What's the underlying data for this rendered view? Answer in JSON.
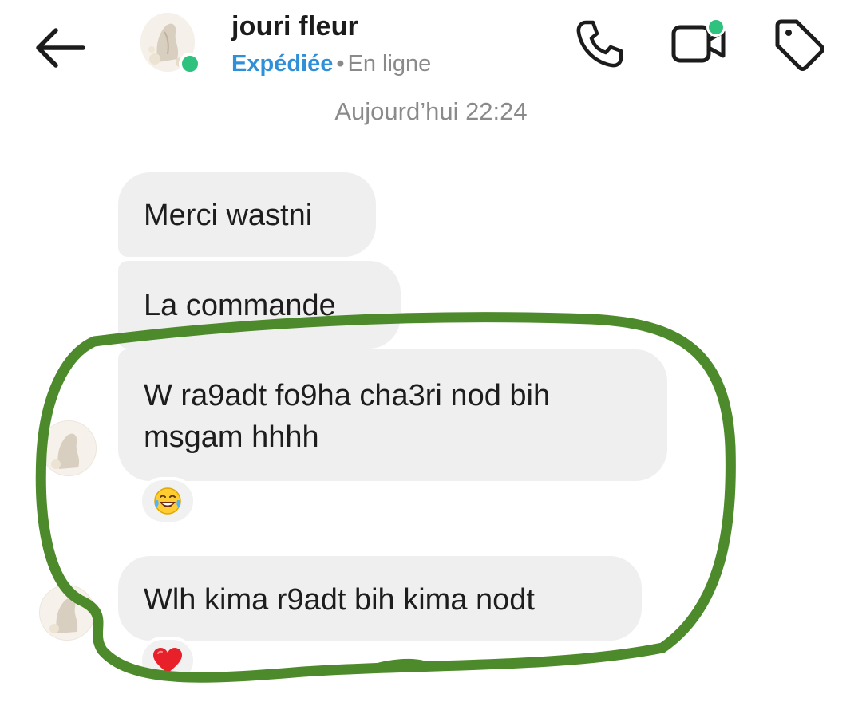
{
  "header": {
    "contact_name": "jouri fleur",
    "status_sent": "Expédiée",
    "status_separator": "•",
    "status_online": "En ligne"
  },
  "timestamp": "Aujourd’hui 22:24",
  "messages": [
    {
      "text": "Merci wastni"
    },
    {
      "text": "La commande"
    },
    {
      "text": "W ra9adt fo9ha cha3ri nod bih msgam hhhh",
      "reaction": "face-with-tears-of-joy-emoji"
    },
    {
      "text": "Wlh kima r9adt bih kima nodt",
      "reaction": "red-heart-emoji"
    }
  ],
  "colors": {
    "online": "#2ec27e",
    "sent_status": "#2f8fd8",
    "bubble": "#efefef",
    "annotation_stroke": "#4d8a2b"
  },
  "icons": {
    "back": "arrow-left-icon",
    "call": "phone-icon",
    "video": "video-camera-icon",
    "tag": "tag-icon"
  }
}
